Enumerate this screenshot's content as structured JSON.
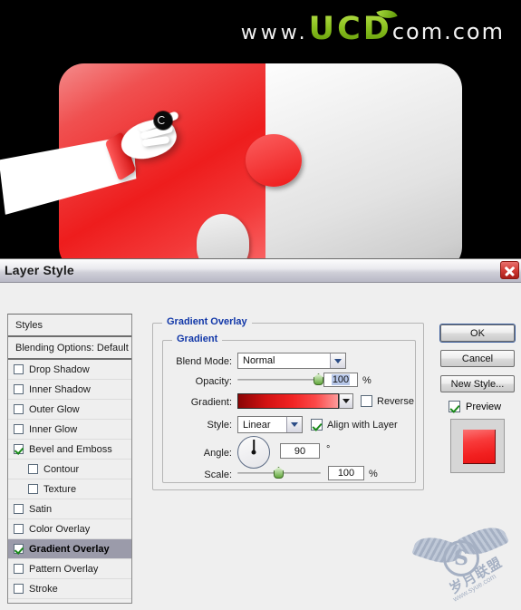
{
  "watermarks": {
    "top": {
      "prefix": "www.",
      "brand": "UCD",
      "suffix": "com.com",
      "leaf_icon": "leaf-icon"
    },
    "bottom": {
      "monogram": "S",
      "cn_text": "岁月联盟",
      "url": "www.syue.com"
    }
  },
  "hero": {
    "alt": "Red and silver jigsaw puzzle pieces with a pointing hand",
    "left_piece_color": "#ee1d1d",
    "right_piece_color": "#e2e2e2"
  },
  "dialog": {
    "title": "Layer Style",
    "close_icon": "close-icon"
  },
  "styles_panel": {
    "header": "Styles",
    "blending_options": "Blending Options: Default",
    "items": [
      {
        "label": "Drop Shadow",
        "checked": false,
        "indent": false,
        "selected": false
      },
      {
        "label": "Inner Shadow",
        "checked": false,
        "indent": false,
        "selected": false
      },
      {
        "label": "Outer Glow",
        "checked": false,
        "indent": false,
        "selected": false
      },
      {
        "label": "Inner Glow",
        "checked": false,
        "indent": false,
        "selected": false
      },
      {
        "label": "Bevel and Emboss",
        "checked": true,
        "indent": false,
        "selected": false
      },
      {
        "label": "Contour",
        "checked": false,
        "indent": true,
        "selected": false
      },
      {
        "label": "Texture",
        "checked": false,
        "indent": true,
        "selected": false
      },
      {
        "label": "Satin",
        "checked": false,
        "indent": false,
        "selected": false
      },
      {
        "label": "Color Overlay",
        "checked": false,
        "indent": false,
        "selected": false
      },
      {
        "label": "Gradient Overlay",
        "checked": true,
        "indent": false,
        "selected": true
      },
      {
        "label": "Pattern Overlay",
        "checked": false,
        "indent": false,
        "selected": false
      },
      {
        "label": "Stroke",
        "checked": false,
        "indent": false,
        "selected": false
      }
    ]
  },
  "gradient_overlay": {
    "section_title": "Gradient Overlay",
    "group_title": "Gradient",
    "blend_mode": {
      "label": "Blend Mode:",
      "value": "Normal"
    },
    "opacity": {
      "label": "Opacity:",
      "value": "100",
      "unit": "%",
      "slider_pct": 100
    },
    "gradient": {
      "label": "Gradient:",
      "swatch_from": "#8a0505",
      "swatch_to": "#fd9b9b",
      "reverse_label": "Reverse",
      "reverse_checked": false
    },
    "style": {
      "label": "Style:",
      "value": "Linear",
      "align_label": "Align with Layer",
      "align_checked": true
    },
    "angle": {
      "label": "Angle:",
      "value": "90",
      "unit": "°",
      "degrees": 90
    },
    "scale": {
      "label": "Scale:",
      "value": "100",
      "unit": "%",
      "slider_pct": 50
    }
  },
  "buttons": {
    "ok": "OK",
    "cancel": "Cancel",
    "new_style": "New Style...",
    "preview_label": "Preview",
    "preview_checked": true,
    "preview_color": "#f22020"
  }
}
